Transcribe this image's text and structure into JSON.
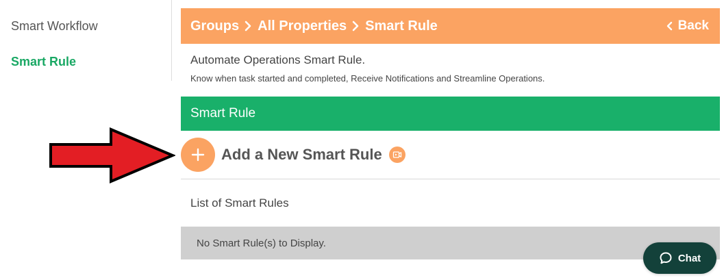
{
  "sidebar": {
    "items": [
      {
        "label": "Smart Workflow"
      },
      {
        "label": "Smart Rule"
      }
    ]
  },
  "header": {
    "breadcrumbs": [
      "Groups",
      "All Properties",
      "Smart Rule"
    ],
    "back_label": "Back"
  },
  "intro": {
    "title": "Automate Operations Smart Rule.",
    "subtitle": "Know when task started and completed, Receive Notifications and Streamline Operations."
  },
  "section": {
    "title": "Smart Rule",
    "add_label": "Add a New Smart Rule",
    "list_title": "List of Smart Rules",
    "empty_message": "No Smart Rule(s) to Display."
  },
  "chat": {
    "label": "Chat"
  },
  "icons": {
    "add": "plus-icon",
    "video": "video-icon",
    "back": "chevron-left-icon",
    "separator": "chevron-right-icon",
    "chat": "chat-bubble-icon",
    "annotation": "red-arrow"
  },
  "colors": {
    "accent_orange": "#fba362",
    "green": "#19b06a",
    "sidebar_active": "#19a864",
    "empty_bg": "#cfcfcf",
    "chat_bg": "#13413a",
    "arrow_red": "#e31e24"
  }
}
